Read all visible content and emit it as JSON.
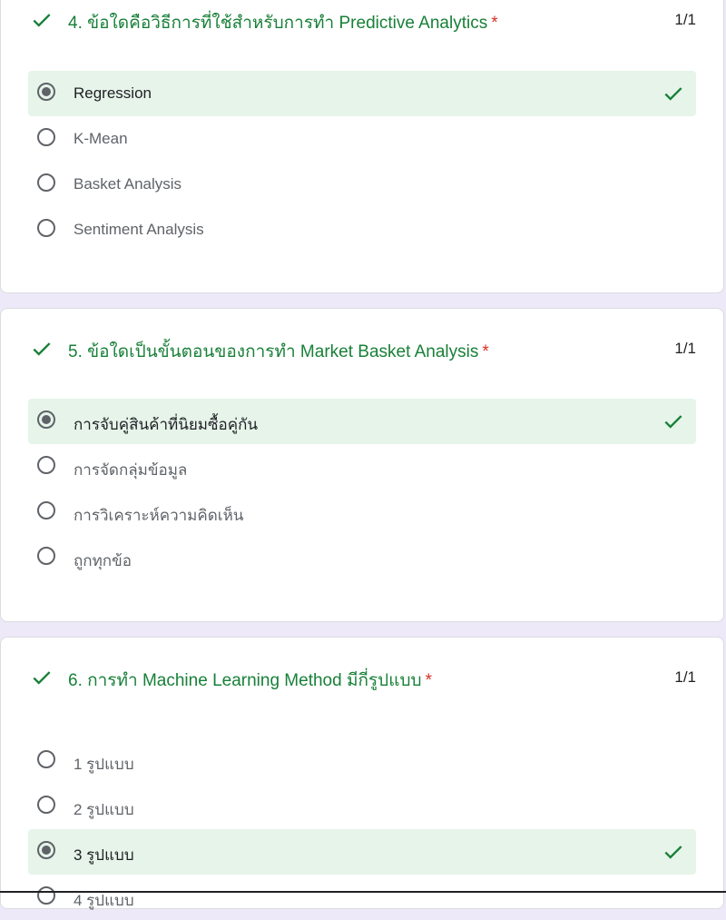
{
  "colors": {
    "correct": "#188038",
    "required": "#d93025",
    "correct_bg": "#e6f4ea",
    "page_bg": "#ede9f8"
  },
  "questions": [
    {
      "title": "4. ข้อใดคือวิธีการที่ใช้สำหรับการทำ Predictive Analytics",
      "required_mark": "*",
      "score": "1/1",
      "status_icon": "check-icon",
      "options": [
        {
          "label": "Regression",
          "selected": true,
          "correct": true
        },
        {
          "label": "K-Mean",
          "selected": false
        },
        {
          "label": "Basket Analysis",
          "selected": false
        },
        {
          "label": "Sentiment Analysis",
          "selected": false
        }
      ]
    },
    {
      "title": "5. ข้อใดเป็นขั้นตอนของการทำ Market Basket Analysis",
      "required_mark": "*",
      "score": "1/1",
      "status_icon": "check-icon",
      "options": [
        {
          "label": "การจับคู่สินค้าที่นิยมซื้อคู่กัน",
          "selected": true,
          "correct": true
        },
        {
          "label": "การจัดกลุ่มข้อมูล",
          "selected": false
        },
        {
          "label": "การวิเคราะห์ความคิดเห็น",
          "selected": false
        },
        {
          "label": "ถูกทุกข้อ",
          "selected": false
        }
      ]
    },
    {
      "title": "6. การทำ Machine Learning Method มีกี่รูปแบบ",
      "required_mark": "*",
      "score": "1/1",
      "status_icon": "check-icon",
      "options": [
        {
          "label": "1 รูปแบบ",
          "selected": false
        },
        {
          "label": "2 รูปแบบ",
          "selected": false
        },
        {
          "label": "3 รูปแบบ",
          "selected": true,
          "correct": true
        },
        {
          "label": "4 รูปแบบ",
          "selected": false
        }
      ]
    }
  ]
}
